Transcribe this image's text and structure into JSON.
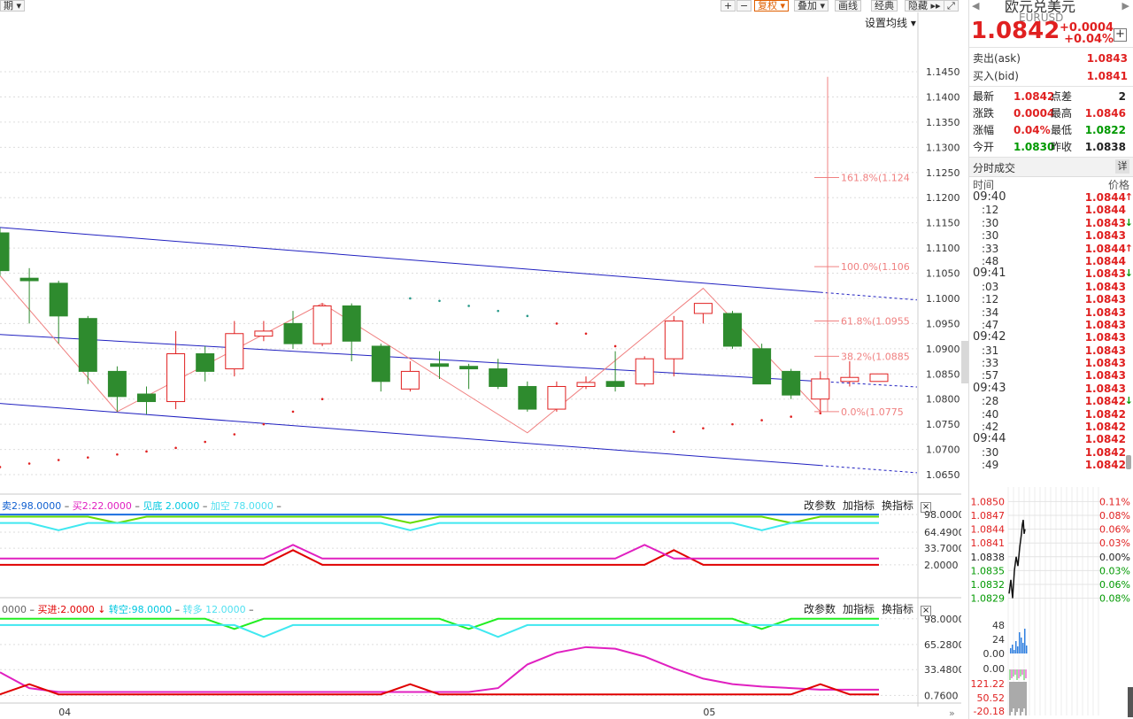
{
  "toolbar": {
    "left_fragment": "期 ▾",
    "buttons": [
      "+",
      "−",
      "复权 ▾",
      "叠加 ▾",
      "画线",
      "经典",
      "隐藏 ▸▸",
      "⤢"
    ],
    "set_ma": "设置均线 ▾"
  },
  "chart_data": [
    {
      "type": "candlestick",
      "title": "",
      "xlabel": "",
      "ylabel": "",
      "x_tick_labels": [
        "04",
        "05"
      ],
      "y_ticks": [
        "1.1450",
        "1.1400",
        "1.1350",
        "1.1300",
        "1.1250",
        "1.1200",
        "1.1150",
        "1.1100",
        "1.1050",
        "1.1000",
        "1.0950",
        "1.0900",
        "1.0850",
        "1.0800",
        "1.0750",
        "1.0700",
        "1.0650"
      ],
      "ylim": [
        1.065,
        1.145
      ],
      "candles": [
        {
          "o": 1.113,
          "h": 1.114,
          "l": 1.1045,
          "c": 1.1055
        },
        {
          "o": 1.104,
          "h": 1.106,
          "l": 1.095,
          "c": 1.1035
        },
        {
          "o": 1.103,
          "h": 1.1035,
          "l": 1.091,
          "c": 1.0965
        },
        {
          "o": 1.096,
          "h": 1.0965,
          "l": 1.083,
          "c": 1.0855
        },
        {
          "o": 1.0855,
          "h": 1.0865,
          "l": 1.0775,
          "c": 1.0805
        },
        {
          "o": 1.081,
          "h": 1.0825,
          "l": 1.077,
          "c": 1.0795
        },
        {
          "o": 1.0795,
          "h": 1.0935,
          "l": 1.078,
          "c": 1.089
        },
        {
          "o": 1.089,
          "h": 1.0905,
          "l": 1.0835,
          "c": 1.0855
        },
        {
          "o": 1.086,
          "h": 1.0955,
          "l": 1.0845,
          "c": 1.093
        },
        {
          "o": 1.0925,
          "h": 1.0955,
          "l": 1.0915,
          "c": 1.0935
        },
        {
          "o": 1.095,
          "h": 1.0975,
          "l": 1.09,
          "c": 1.091
        },
        {
          "o": 1.091,
          "h": 1.099,
          "l": 1.0905,
          "c": 1.0985
        },
        {
          "o": 1.0985,
          "h": 1.099,
          "l": 1.0875,
          "c": 1.0915
        },
        {
          "o": 1.0905,
          "h": 1.091,
          "l": 1.0815,
          "c": 1.0835
        },
        {
          "o": 1.082,
          "h": 1.0875,
          "l": 1.0815,
          "c": 1.0855
        },
        {
          "o": 1.087,
          "h": 1.0895,
          "l": 1.084,
          "c": 1.0865
        },
        {
          "o": 1.0865,
          "h": 1.087,
          "l": 1.082,
          "c": 1.086
        },
        {
          "o": 1.086,
          "h": 1.088,
          "l": 1.082,
          "c": 1.0825
        },
        {
          "o": 1.0825,
          "h": 1.0835,
          "l": 1.0775,
          "c": 1.078
        },
        {
          "o": 1.078,
          "h": 1.0835,
          "l": 1.0775,
          "c": 1.0825
        },
        {
          "o": 1.0825,
          "h": 1.0845,
          "l": 1.082,
          "c": 1.0833
        },
        {
          "o": 1.0835,
          "h": 1.0895,
          "l": 1.0815,
          "c": 1.0825
        },
        {
          "o": 1.083,
          "h": 1.0885,
          "l": 1.0825,
          "c": 1.088
        },
        {
          "o": 1.088,
          "h": 1.0965,
          "l": 1.0845,
          "c": 1.0955
        },
        {
          "o": 1.097,
          "h": 1.0985,
          "l": 1.095,
          "c": 1.099
        },
        {
          "o": 1.097,
          "h": 1.0975,
          "l": 1.09,
          "c": 1.0905
        },
        {
          "o": 1.09,
          "h": 1.091,
          "l": 1.083,
          "c": 1.083
        },
        {
          "o": 1.0855,
          "h": 1.086,
          "l": 1.08,
          "c": 1.0808
        },
        {
          "o": 1.08,
          "h": 1.0855,
          "l": 1.0775,
          "c": 1.084
        },
        {
          "o": 1.0835,
          "h": 1.0875,
          "l": 1.0825,
          "c": 1.0843
        },
        {
          "o": 1.0835,
          "h": 1.085,
          "l": 1.0835,
          "c": 1.085
        }
      ],
      "sar_dots": [
        {
          "i": 0,
          "v": 1.0665
        },
        {
          "i": 1,
          "v": 1.0672
        },
        {
          "i": 2,
          "v": 1.0679
        },
        {
          "i": 3,
          "v": 1.0684
        },
        {
          "i": 4,
          "v": 1.069
        },
        {
          "i": 5,
          "v": 1.0696
        },
        {
          "i": 6,
          "v": 1.0703
        },
        {
          "i": 7,
          "v": 1.0715
        },
        {
          "i": 8,
          "v": 1.073
        },
        {
          "i": 9,
          "v": 1.075
        },
        {
          "i": 10,
          "v": 1.0775
        },
        {
          "i": 11,
          "v": 1.08
        },
        {
          "i": 14,
          "v": 1.1
        },
        {
          "i": 15,
          "v": 1.0995
        },
        {
          "i": 16,
          "v": 1.0985
        },
        {
          "i": 17,
          "v": 1.0975
        },
        {
          "i": 18,
          "v": 1.0965
        },
        {
          "i": 19,
          "v": 1.095
        },
        {
          "i": 20,
          "v": 1.093
        },
        {
          "i": 21,
          "v": 1.0905
        },
        {
          "i": 23,
          "v": 1.0735
        },
        {
          "i": 24,
          "v": 1.0742
        },
        {
          "i": 25,
          "v": 1.075
        },
        {
          "i": 26,
          "v": 1.0758
        },
        {
          "i": 27,
          "v": 1.0765
        },
        {
          "i": 28,
          "v": 1.0772
        }
      ],
      "zigzag": [
        {
          "i": 0,
          "v": 1.1045
        },
        {
          "i": 4,
          "v": 1.0775
        },
        {
          "i": 11,
          "v": 1.099
        },
        {
          "i": 18,
          "v": 1.0733
        },
        {
          "i": 24,
          "v": 1.102
        },
        {
          "i": 28,
          "v": 1.0775
        }
      ],
      "channel_lines": [
        {
          "from": {
            "i": -2,
            "v": 1.115
          },
          "to": {
            "i": 28,
            "v": 1.1012
          }
        },
        {
          "from": {
            "i": -2,
            "v": 1.0935
          },
          "to": {
            "i": 31,
            "v": 1.0825
          }
        },
        {
          "from": {
            "i": -2,
            "v": 1.08
          },
          "to": {
            "i": 31,
            "v": 1.0655
          }
        }
      ],
      "fibonacci": [
        {
          "label": "161.8%(1.124",
          "v": 1.124
        },
        {
          "label": "100.0%(1.106",
          "v": 1.1063
        },
        {
          "label": "61.8%(1.0955",
          "v": 1.0955
        },
        {
          "label": "38.2%(1.0885",
          "v": 1.0885
        },
        {
          "label": "0.0%(1.0775",
          "v": 1.0775
        }
      ]
    },
    {
      "type": "line",
      "legend": [
        {
          "name": "卖2:98.0000",
          "color": "#1060d0"
        },
        {
          "name": "买2:22.0000",
          "color": "#e020c0"
        },
        {
          "name": "见底 2.0000",
          "color": "#00c8e0"
        },
        {
          "name": "加空 78.0000",
          "color": "#50e0f0"
        }
      ],
      "y_ticks": [
        "98.0000",
        "64.4900",
        "33.7000",
        "2.0000"
      ],
      "ylim": [
        0,
        100
      ],
      "series": [
        {
          "name": "blue",
          "color": "#1a6ee0",
          "values": [
            98,
            98,
            98,
            98,
            98,
            98,
            98,
            98,
            98,
            98,
            98,
            98,
            98,
            98,
            98,
            98,
            98,
            98,
            98,
            98,
            98,
            98,
            98,
            98,
            98,
            98,
            98,
            98,
            98,
            98,
            98
          ]
        },
        {
          "name": "green",
          "color": "#66dd00",
          "values": [
            94,
            94,
            94,
            94,
            82,
            94,
            94,
            94,
            94,
            94,
            94,
            94,
            94,
            94,
            82,
            94,
            94,
            94,
            94,
            94,
            94,
            94,
            94,
            94,
            94,
            94,
            94,
            82,
            94,
            94,
            94
          ]
        },
        {
          "name": "cyan",
          "color": "#40e8f0",
          "values": [
            82,
            82,
            68,
            82,
            82,
            82,
            82,
            82,
            82,
            82,
            82,
            82,
            82,
            82,
            68,
            82,
            82,
            82,
            82,
            82,
            82,
            82,
            82,
            82,
            82,
            82,
            68,
            82,
            82,
            82,
            82
          ]
        },
        {
          "name": "red",
          "color": "#e00000",
          "values": [
            2,
            2,
            2,
            2,
            2,
            2,
            2,
            2,
            2,
            2,
            30,
            2,
            2,
            2,
            2,
            2,
            2,
            2,
            2,
            2,
            2,
            2,
            2,
            30,
            2,
            2,
            2,
            2,
            2,
            2,
            2
          ]
        },
        {
          "name": "magenta",
          "color": "#e020c0",
          "values": [
            14,
            14,
            14,
            14,
            14,
            14,
            14,
            14,
            14,
            14,
            40,
            14,
            14,
            14,
            14,
            14,
            14,
            14,
            14,
            14,
            14,
            14,
            40,
            14,
            14,
            14,
            14,
            14,
            14,
            14,
            14
          ]
        }
      ]
    },
    {
      "type": "line",
      "legend": [
        {
          "name": "0000",
          "color": "#888"
        },
        {
          "name": "买进:2.0000 ↓",
          "color": "#e00000"
        },
        {
          "name": "转空:98.0000",
          "color": "#00c8e0"
        },
        {
          "name": "转多 12.0000",
          "color": "#50e0f0"
        }
      ],
      "y_ticks": [
        "98.0000",
        "65.2800",
        "33.4800",
        "0.7600"
      ],
      "ylim": [
        0,
        100
      ],
      "series": [
        {
          "name": "green",
          "color": "#22ee22",
          "values": [
            98,
            98,
            98,
            98,
            98,
            98,
            98,
            98,
            85,
            98,
            98,
            98,
            98,
            98,
            98,
            98,
            85,
            98,
            98,
            98,
            98,
            98,
            98,
            98,
            98,
            98,
            85,
            98,
            98,
            98,
            98
          ]
        },
        {
          "name": "cyan",
          "color": "#40e8f0",
          "values": [
            90,
            90,
            90,
            90,
            90,
            90,
            90,
            90,
            90,
            75,
            90,
            90,
            90,
            90,
            90,
            90,
            90,
            75,
            90,
            90,
            90,
            90,
            90,
            90,
            90,
            90,
            90,
            90,
            90,
            90,
            90
          ]
        },
        {
          "name": "magenta",
          "color": "#e020c0",
          "values": [
            30,
            10,
            5,
            5,
            5,
            5,
            5,
            5,
            5,
            5,
            5,
            5,
            5,
            5,
            5,
            5,
            5,
            10,
            40,
            55,
            62,
            60,
            50,
            35,
            22,
            15,
            12,
            10,
            8,
            8,
            8
          ]
        },
        {
          "name": "red",
          "color": "#e00000",
          "values": [
            2,
            15,
            2,
            2,
            2,
            2,
            2,
            2,
            2,
            2,
            2,
            2,
            2,
            2,
            15,
            2,
            2,
            2,
            2,
            2,
            2,
            2,
            2,
            2,
            2,
            2,
            2,
            2,
            15,
            2,
            2
          ]
        }
      ]
    },
    {
      "type": "line",
      "title": "分时",
      "y_ticks": [
        "1.0850",
        "1.0847",
        "1.0844",
        "1.0841",
        "1.0838",
        "1.0835",
        "1.0832",
        "1.0829"
      ],
      "pct_ticks": [
        "0.11%",
        "0.08%",
        "0.06%",
        "0.03%",
        "0.00%",
        "0.03%",
        "0.06%",
        "0.08%"
      ],
      "ylim": [
        1.0827,
        1.0852
      ],
      "vol_ticks": [
        "48",
        "24",
        "0.00"
      ],
      "ind_ticks": [
        "0.00",
        "121.22",
        "50.52",
        "-20.18"
      ]
    }
  ],
  "panel_tools": [
    "改参数",
    "加指标",
    "换指标"
  ],
  "close_glyph": "×",
  "quote": {
    "name": "欧元兑美元",
    "code": "EURUSD",
    "price": "1.0842",
    "change": "+0.0004",
    "change_pct": "+0.04%",
    "plus": "+",
    "ask_label": "卖出(ask)",
    "ask": "1.0843",
    "bid_label": "买入(bid)",
    "bid": "1.0841",
    "stats": [
      {
        "l": "最新",
        "v": "1.0842",
        "c": "red",
        "l2": "点差",
        "v2": "2",
        "c2": "black"
      },
      {
        "l": "涨跌",
        "v": "0.0004",
        "c": "red",
        "l2": "最高",
        "v2": "1.0846",
        "c2": "red"
      },
      {
        "l": "涨幅",
        "v": "0.04%",
        "c": "red",
        "l2": "最低",
        "v2": "1.0822",
        "c2": "green"
      },
      {
        "l": "今开",
        "v": "1.0830",
        "c": "green",
        "l2": "昨收",
        "v2": "1.0838",
        "c2": "black"
      }
    ]
  },
  "ticks": {
    "title": "分时成交",
    "detail": "详",
    "col_time": "时间",
    "col_price": "价格",
    "rows": [
      {
        "t": "09:40",
        "p": "1.0844",
        "a": "↑",
        "big": true
      },
      {
        "t": ":12",
        "p": "1.0844",
        "a": ""
      },
      {
        "t": ":30",
        "p": "1.0843",
        "a": "↓"
      },
      {
        "t": ":30",
        "p": "1.0843",
        "a": ""
      },
      {
        "t": ":33",
        "p": "1.0844",
        "a": "↑"
      },
      {
        "t": ":48",
        "p": "1.0844",
        "a": ""
      },
      {
        "t": "09:41",
        "p": "1.0843",
        "a": "↓",
        "big": true
      },
      {
        "t": ":03",
        "p": "1.0843",
        "a": ""
      },
      {
        "t": ":12",
        "p": "1.0843",
        "a": ""
      },
      {
        "t": ":34",
        "p": "1.0843",
        "a": ""
      },
      {
        "t": ":47",
        "p": "1.0843",
        "a": ""
      },
      {
        "t": "09:42",
        "p": "1.0843",
        "a": "",
        "big": true
      },
      {
        "t": ":31",
        "p": "1.0843",
        "a": ""
      },
      {
        "t": ":33",
        "p": "1.0843",
        "a": ""
      },
      {
        "t": ":57",
        "p": "1.0843",
        "a": ""
      },
      {
        "t": "09:43",
        "p": "1.0843",
        "a": "",
        "big": true
      },
      {
        "t": ":28",
        "p": "1.0842",
        "a": "↓"
      },
      {
        "t": ":40",
        "p": "1.0842",
        "a": ""
      },
      {
        "t": ":42",
        "p": "1.0842",
        "a": ""
      },
      {
        "t": "09:44",
        "p": "1.0842",
        "a": "",
        "big": true
      },
      {
        "t": ":30",
        "p": "1.0842",
        "a": ""
      },
      {
        "t": ":49",
        "p": "1.0842",
        "a": ""
      }
    ]
  },
  "colors": {
    "up": "#e02020",
    "down": "#2e8b2e",
    "grid": "#dddddd",
    "channel": "#2020c0",
    "zigzag": "#f08080",
    "fib": "#f08080"
  }
}
